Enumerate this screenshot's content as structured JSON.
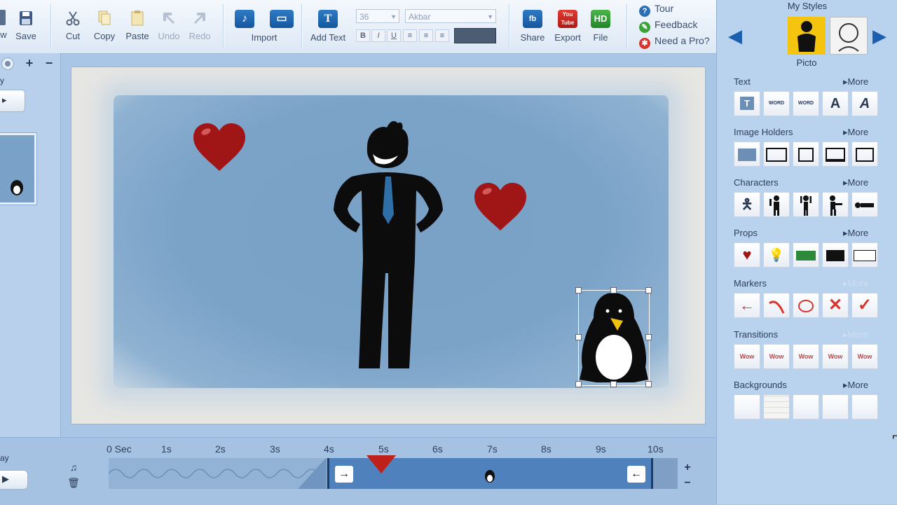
{
  "toolbar": {
    "new_label": "w",
    "save_label": "Save",
    "cut_label": "Cut",
    "copy_label": "Copy",
    "paste_label": "Paste",
    "undo_label": "Undo",
    "redo_label": "Redo",
    "import_label": "Import",
    "add_text_label": "Add Text",
    "font_size": "36",
    "font_name": "Akbar",
    "bold_label": "B",
    "italic_label": "I",
    "underline_label": "U",
    "share_label": "Share",
    "export_label": "Export",
    "file_label": "File",
    "hd_badge": "HD",
    "youtube_badge": "You Tube",
    "tour_label": "Tour",
    "feedback_label": "Feedback",
    "pro_label": "Need a Pro?"
  },
  "left_panel": {
    "label1": "y",
    "play_label": "ay"
  },
  "right_panel": {
    "title": "My Styles",
    "selected_style": "Picto",
    "sections": [
      {
        "name": "Text",
        "more": "More"
      },
      {
        "name": "Image Holders",
        "more": "More"
      },
      {
        "name": "Characters",
        "more": "More"
      },
      {
        "name": "Props",
        "more": "More"
      },
      {
        "name": "Markers",
        "more": "More"
      },
      {
        "name": "Transitions",
        "more": "More"
      },
      {
        "name": "Backgrounds",
        "more": "More"
      }
    ],
    "text_tiles": [
      "T",
      "WORD",
      "WORD",
      "A",
      "A"
    ],
    "transition_tiles": [
      "Wow",
      "Wow",
      "Wow",
      "Wow",
      "Wow"
    ],
    "background_colors": [
      "#f2f3f4",
      "#f4f4f2",
      "#f5b90c",
      "#e84343",
      "#5e97d6"
    ]
  },
  "timeline": {
    "ticks": [
      "0 Sec",
      "1s",
      "2s",
      "3s",
      "4s",
      "5s",
      "6s",
      "7s",
      "8s",
      "9s",
      "10s"
    ],
    "zoom_in": "+",
    "zoom_out": "−"
  },
  "colors": {
    "accent": "#1b5fae",
    "heart": "#a01515",
    "tie": "#2f6fa8",
    "playhead": "#c0201a"
  }
}
